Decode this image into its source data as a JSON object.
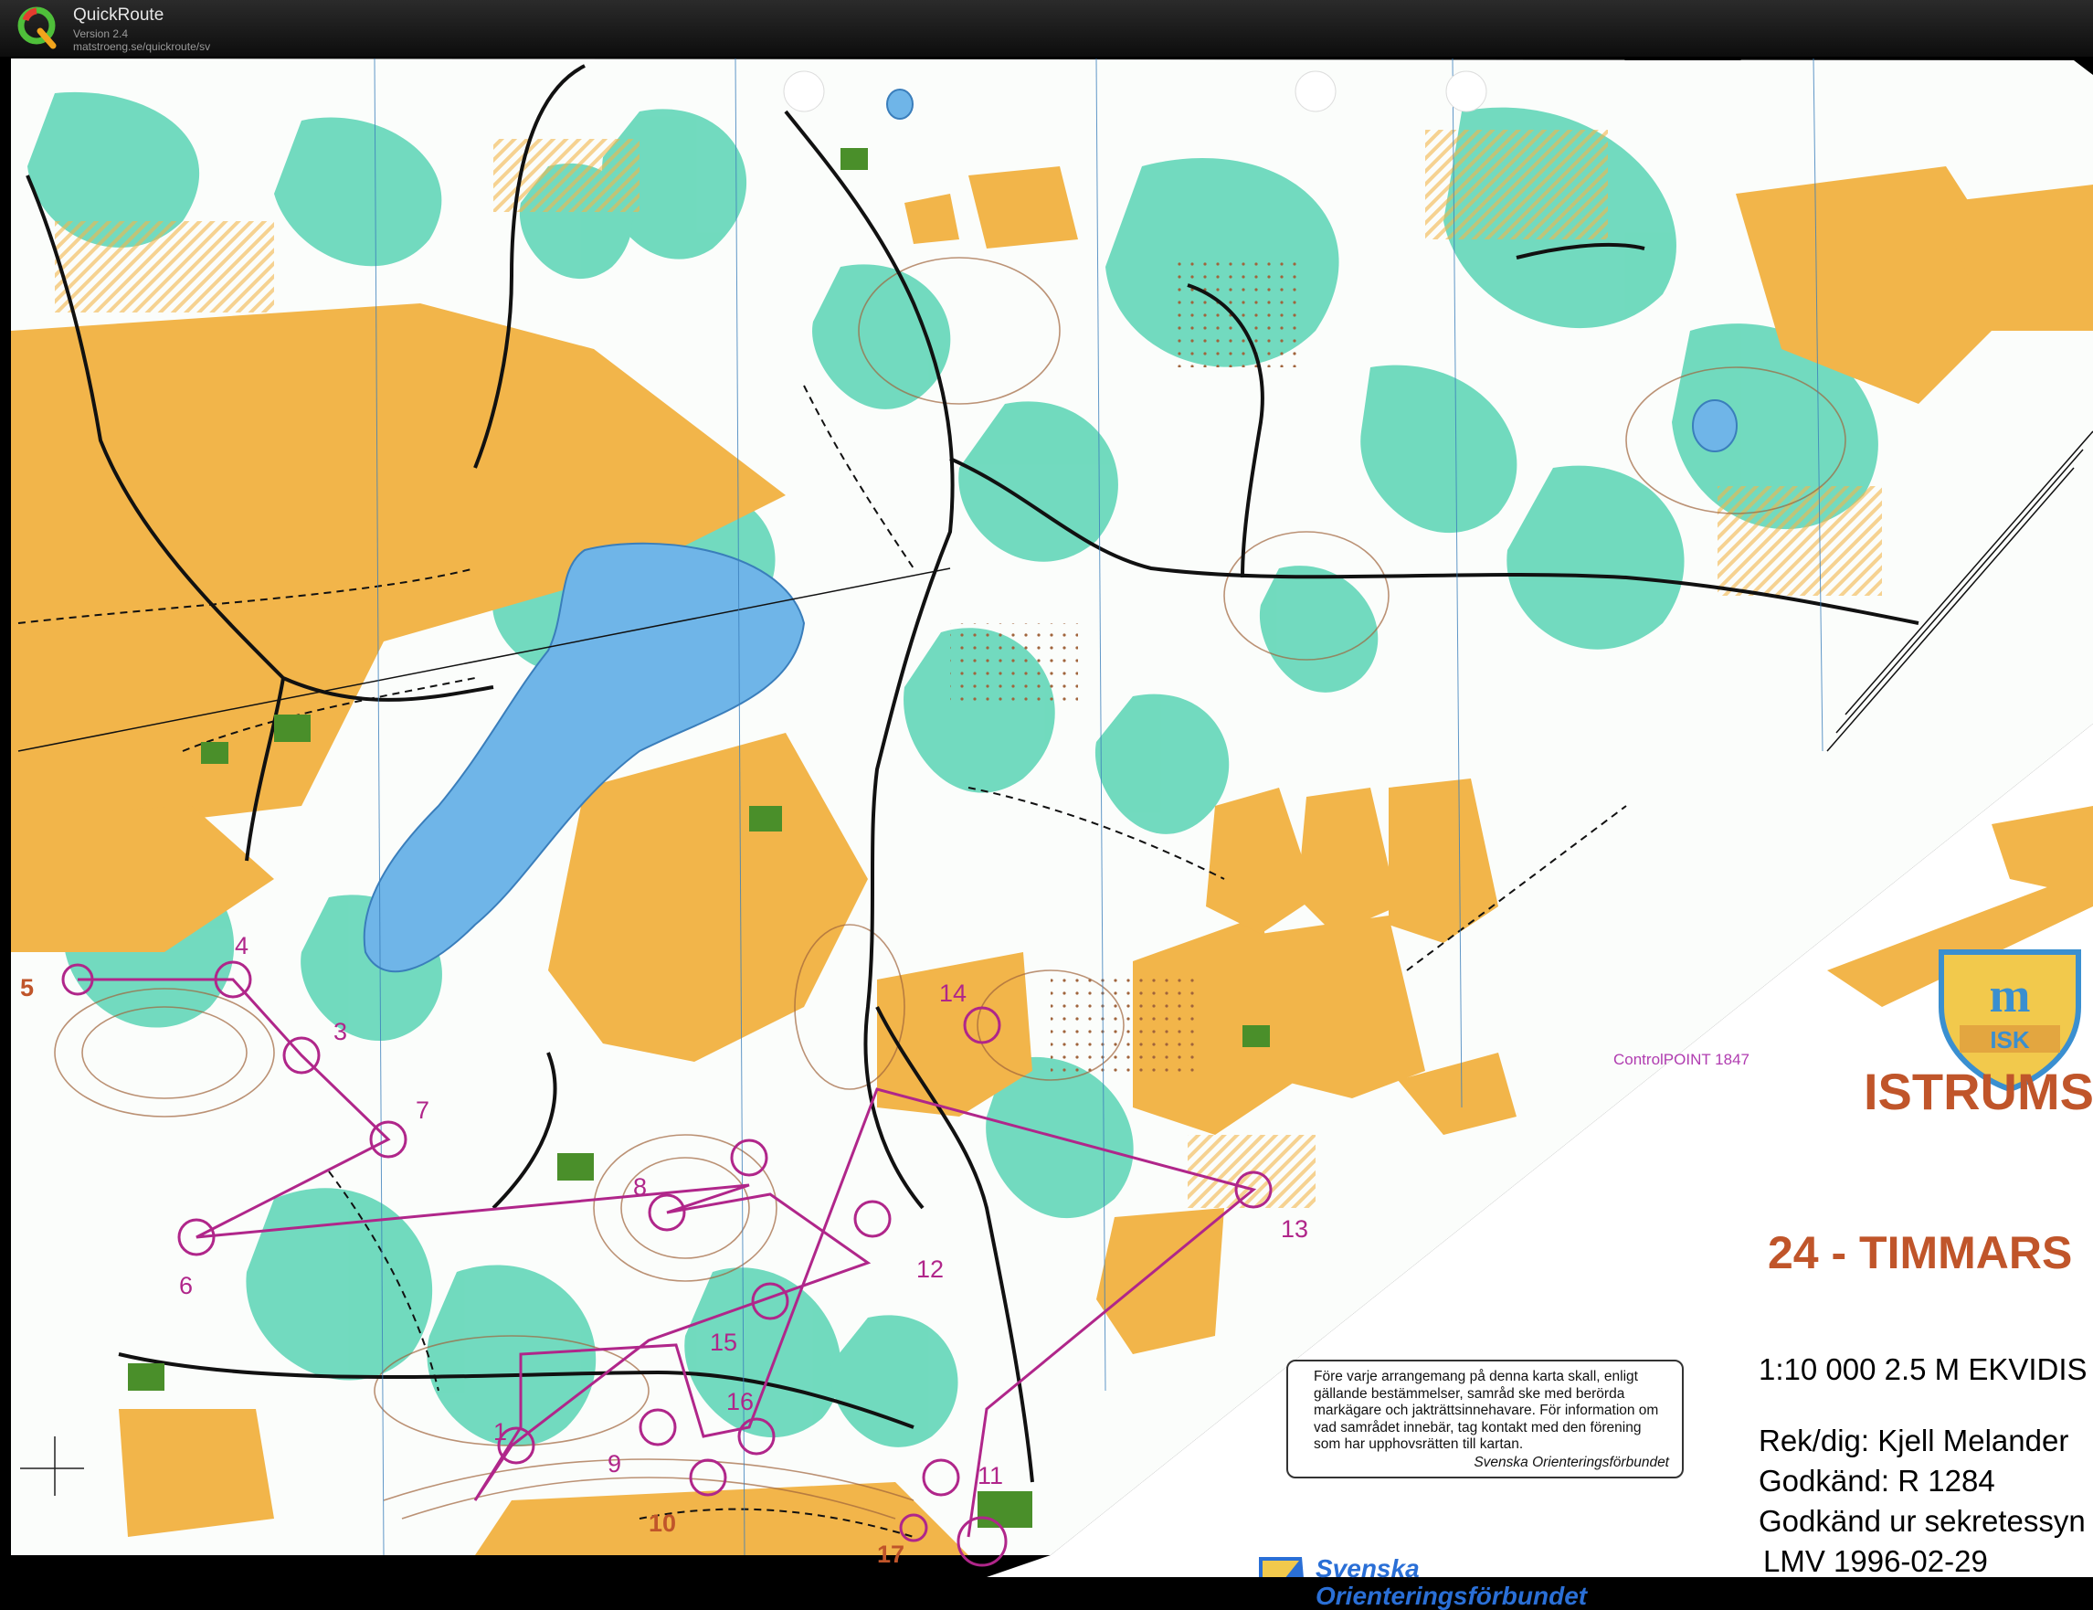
{
  "app": {
    "name": "QuickRoute",
    "version": "Version 2.4",
    "url": "matstroeng.se/quickroute/sv",
    "logo_letter": "Q"
  },
  "map": {
    "club_name": "ISTRUMS",
    "event_name": "24 - TIMMARS",
    "logo_text": "ISK",
    "controlpoint_label": "ControlPOINT 1847",
    "scale_line": "1:10 000  2.5 M EKVIDIS",
    "rek_dig": "Rek/dig: Kjell Melander",
    "godkand": "Godkänd: R 1284",
    "secret": "Godkänd ur sekretessyn",
    "lmv": "LMV 1996-02-29",
    "notice_text": "Före varje arrangemang på denna karta skall, enligt gällande bestämmelser, samråd ske med berörda markägare och jakträttsinnehavare. För information om vad samrådet innebär, tag kontakt med den förening som har upphovsrätten till kartan.",
    "notice_signature": "Svenska Orienteringsförbundet",
    "sof_line1": "Svenska",
    "sof_line2": "Orienteringsförbundet",
    "control_numbers": [
      "1",
      "3",
      "4",
      "5",
      "6",
      "7",
      "8",
      "9",
      "10",
      "11",
      "12",
      "13",
      "14",
      "15",
      "16",
      "17"
    ],
    "colors": {
      "open_land": "#f2b54a",
      "forest": "#ffffff",
      "green_vegetation": "#4fd1b0",
      "water": "#6fb5e8",
      "course_overprint": "#b0268a",
      "contours": "#a0643c",
      "roads_paths": "#111111"
    }
  }
}
